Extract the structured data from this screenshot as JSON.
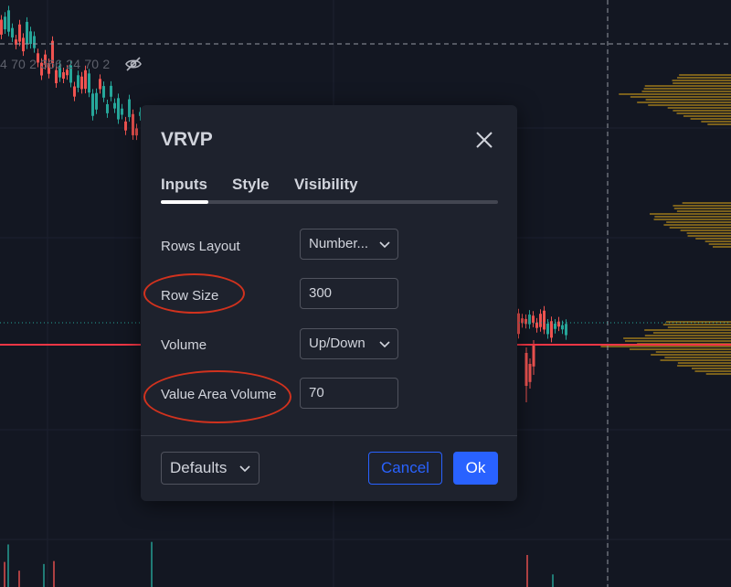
{
  "chart": {
    "legend_values": "4 70 2 366 24 70 2",
    "colors": {
      "background": "#131722",
      "up": "#26a69a",
      "down": "#ef5350",
      "profile": "#d4a017",
      "price_line": "#f23645"
    }
  },
  "dialog": {
    "title": "VRVP",
    "tabs": [
      {
        "label": "Inputs",
        "active": true
      },
      {
        "label": "Style",
        "active": false
      },
      {
        "label": "Visibility",
        "active": false
      }
    ],
    "fields": {
      "rows_layout": {
        "label": "Rows Layout",
        "value": "Number...",
        "type": "select"
      },
      "row_size": {
        "label": "Row Size",
        "value": "300",
        "type": "input"
      },
      "volume": {
        "label": "Volume",
        "value": "Up/Down",
        "type": "select"
      },
      "value_area_volume": {
        "label": "Value Area Volume",
        "value": "70",
        "type": "input"
      }
    },
    "footer": {
      "defaults_label": "Defaults",
      "cancel_label": "Cancel",
      "ok_label": "Ok"
    }
  },
  "colors": {
    "accent": "#2962ff",
    "annotation": "#d1321e",
    "dialog_bg": "#1e222d"
  }
}
